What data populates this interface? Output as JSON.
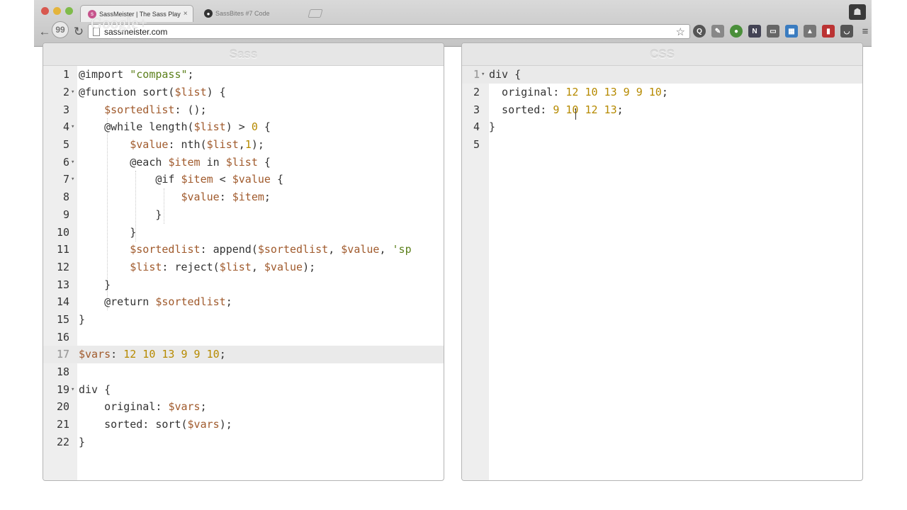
{
  "browser": {
    "tabs": [
      {
        "label": "SassMeister | The Sass Play",
        "close": "×",
        "active": true
      },
      {
        "label": "SassBites #7 Code",
        "active": false
      }
    ],
    "url": "sassmeister.com",
    "hangout_label": "99",
    "overlay_text": "Google+",
    "icons": [
      "back-icon",
      "hangout-icon",
      "reload-icon",
      "star-icon",
      "menu-icon"
    ]
  },
  "sass_pane": {
    "title": "Sass",
    "lines": [
      {
        "n": "1",
        "fold": "",
        "tokens": [
          {
            "t": "@import ",
            "c": "plain"
          },
          {
            "t": "\"compass\"",
            "c": "str"
          },
          {
            "t": ";",
            "c": "plain"
          }
        ]
      },
      {
        "n": "2",
        "fold": "▾",
        "tokens": [
          {
            "t": "@function sort(",
            "c": "plain"
          },
          {
            "t": "$list",
            "c": "var"
          },
          {
            "t": ") {",
            "c": "plain"
          }
        ]
      },
      {
        "n": "3",
        "fold": "",
        "tokens": [
          {
            "t": "    ",
            "c": "plain"
          },
          {
            "t": "$sortedlist",
            "c": "var"
          },
          {
            "t": ": ();",
            "c": "plain"
          }
        ]
      },
      {
        "n": "4",
        "fold": "▾",
        "tokens": [
          {
            "t": "    @while length(",
            "c": "plain"
          },
          {
            "t": "$list",
            "c": "var"
          },
          {
            "t": ") > ",
            "c": "plain"
          },
          {
            "t": "0",
            "c": "num"
          },
          {
            "t": " {",
            "c": "plain"
          }
        ]
      },
      {
        "n": "5",
        "fold": "",
        "tokens": [
          {
            "t": "        ",
            "c": "plain"
          },
          {
            "t": "$value",
            "c": "var"
          },
          {
            "t": ": nth(",
            "c": "plain"
          },
          {
            "t": "$list",
            "c": "var"
          },
          {
            "t": ",",
            "c": "plain"
          },
          {
            "t": "1",
            "c": "num"
          },
          {
            "t": ");",
            "c": "plain"
          }
        ]
      },
      {
        "n": "6",
        "fold": "▾",
        "tokens": [
          {
            "t": "        @each ",
            "c": "plain"
          },
          {
            "t": "$item",
            "c": "var"
          },
          {
            "t": " in ",
            "c": "plain"
          },
          {
            "t": "$list",
            "c": "var"
          },
          {
            "t": " {",
            "c": "plain"
          }
        ]
      },
      {
        "n": "7",
        "fold": "▾",
        "tokens": [
          {
            "t": "            @if ",
            "c": "plain"
          },
          {
            "t": "$item",
            "c": "var"
          },
          {
            "t": " < ",
            "c": "plain"
          },
          {
            "t": "$value",
            "c": "var"
          },
          {
            "t": " {",
            "c": "plain"
          }
        ]
      },
      {
        "n": "8",
        "fold": "",
        "tokens": [
          {
            "t": "                ",
            "c": "plain"
          },
          {
            "t": "$value",
            "c": "var"
          },
          {
            "t": ": ",
            "c": "plain"
          },
          {
            "t": "$item",
            "c": "var"
          },
          {
            "t": ";",
            "c": "plain"
          }
        ]
      },
      {
        "n": "9",
        "fold": "",
        "tokens": [
          {
            "t": "            }",
            "c": "plain"
          }
        ]
      },
      {
        "n": "10",
        "fold": "",
        "tokens": [
          {
            "t": "        }",
            "c": "plain"
          }
        ]
      },
      {
        "n": "11",
        "fold": "",
        "tokens": [
          {
            "t": "        ",
            "c": "plain"
          },
          {
            "t": "$sortedlist",
            "c": "var"
          },
          {
            "t": ": append(",
            "c": "plain"
          },
          {
            "t": "$sortedlist",
            "c": "var"
          },
          {
            "t": ", ",
            "c": "plain"
          },
          {
            "t": "$value",
            "c": "var"
          },
          {
            "t": ", ",
            "c": "plain"
          },
          {
            "t": "'sp",
            "c": "str"
          }
        ]
      },
      {
        "n": "12",
        "fold": "",
        "tokens": [
          {
            "t": "        ",
            "c": "plain"
          },
          {
            "t": "$list",
            "c": "var"
          },
          {
            "t": ": reject(",
            "c": "plain"
          },
          {
            "t": "$list",
            "c": "var"
          },
          {
            "t": ", ",
            "c": "plain"
          },
          {
            "t": "$value",
            "c": "var"
          },
          {
            "t": ");",
            "c": "plain"
          }
        ]
      },
      {
        "n": "13",
        "fold": "",
        "tokens": [
          {
            "t": "    }",
            "c": "plain"
          }
        ]
      },
      {
        "n": "14",
        "fold": "",
        "tokens": [
          {
            "t": "    @return ",
            "c": "plain"
          },
          {
            "t": "$sortedlist",
            "c": "var"
          },
          {
            "t": ";",
            "c": "plain"
          }
        ]
      },
      {
        "n": "15",
        "fold": "",
        "tokens": [
          {
            "t": "}",
            "c": "plain"
          }
        ]
      },
      {
        "n": "16",
        "fold": "",
        "tokens": []
      },
      {
        "n": "17",
        "fold": "",
        "highlight": true,
        "tokens": [
          {
            "t": "$vars",
            "c": "var"
          },
          {
            "t": ": ",
            "c": "plain"
          },
          {
            "t": "12 10 13 9 9 10",
            "c": "num"
          },
          {
            "t": ";",
            "c": "plain"
          }
        ]
      },
      {
        "n": "18",
        "fold": "",
        "tokens": []
      },
      {
        "n": "19",
        "fold": "▾",
        "tokens": [
          {
            "t": "div {",
            "c": "plain"
          }
        ]
      },
      {
        "n": "20",
        "fold": "",
        "tokens": [
          {
            "t": "    original: ",
            "c": "plain"
          },
          {
            "t": "$vars",
            "c": "var"
          },
          {
            "t": ";",
            "c": "plain"
          }
        ]
      },
      {
        "n": "21",
        "fold": "",
        "tokens": [
          {
            "t": "    sorted: sort(",
            "c": "plain"
          },
          {
            "t": "$vars",
            "c": "var"
          },
          {
            "t": ");",
            "c": "plain"
          }
        ]
      },
      {
        "n": "22",
        "fold": "",
        "tokens": [
          {
            "t": "}",
            "c": "plain"
          }
        ]
      }
    ]
  },
  "css_pane": {
    "title": "CSS",
    "lines": [
      {
        "n": "1",
        "fold": "▾",
        "highlight": true,
        "tokens": [
          {
            "t": "div {",
            "c": "plain"
          }
        ]
      },
      {
        "n": "2",
        "fold": "",
        "tokens": [
          {
            "t": "  original: ",
            "c": "plain"
          },
          {
            "t": "12 10 13 9 9 10",
            "c": "num"
          },
          {
            "t": ";",
            "c": "plain"
          }
        ]
      },
      {
        "n": "3",
        "fold": "",
        "tokens": [
          {
            "t": "  sorted: ",
            "c": "plain"
          },
          {
            "t": "9 10 12 13",
            "c": "num"
          },
          {
            "t": ";",
            "c": "plain"
          }
        ]
      },
      {
        "n": "4",
        "fold": "",
        "tokens": [
          {
            "t": "}",
            "c": "plain"
          }
        ]
      },
      {
        "n": "5",
        "fold": "",
        "tokens": []
      }
    ]
  },
  "colors": {
    "variable": "#a05a2c",
    "number": "#b68a00",
    "string": "#5b7f1a",
    "gutter": "#eeeeee",
    "highlight_line": "#eaeaea"
  }
}
